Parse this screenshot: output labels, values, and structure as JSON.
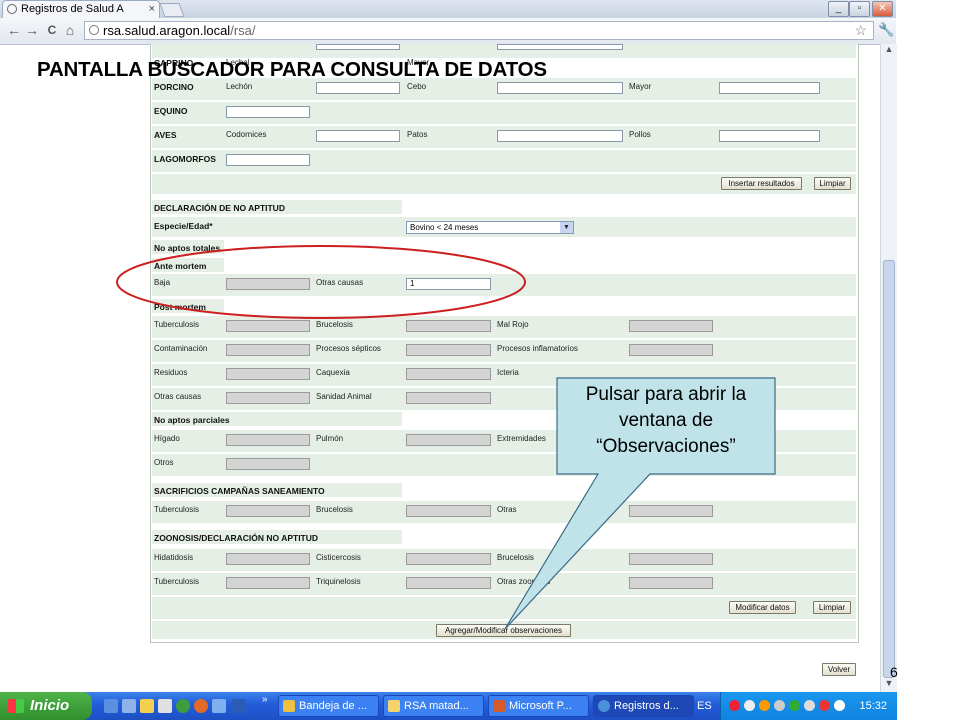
{
  "browser": {
    "tab_title": "Registros de Salud A",
    "tab_close": "×",
    "url_host": "rsa.salud.aragon.local",
    "url_path": "/rsa/",
    "back": "←",
    "forward": "→",
    "reload": "C",
    "home": "⌂",
    "star": "☆",
    "wrench": "🔧",
    "win_min": "_",
    "win_max": "▫",
    "win_close": "✕"
  },
  "slide": {
    "title": "PANTALLA BUSCADOR PARA CONSULTA DE DATOS",
    "callout": "Pulsar para abrir la ventana de “Observaciones”",
    "page_number": "6"
  },
  "form": {
    "top_labels": {
      "caprino": "CAPRINO",
      "caprino_sub": "Lechal",
      "caprino_mayor": "Mayor"
    },
    "porcino": {
      "label": "PORCINO",
      "c1": "Lechón",
      "c2": "Cebo",
      "c3": "Mayor"
    },
    "equino": {
      "label": "EQUINO"
    },
    "aves": {
      "label": "AVES",
      "c1": "Codornices",
      "c2": "Patos",
      "c3": "Pollos"
    },
    "lagomorfos": {
      "label": "LAGOMORFOS"
    },
    "insert_button": "Insertar resultados",
    "clear_button": "Limpiar",
    "no_aptitud": {
      "header": "DECLARACIÓN DE NO APTITUD",
      "species_label": "Especie/Edad*",
      "species_value": "Bovino < 24 meses",
      "no_aptos_totales": "No aptos totales",
      "ante_mortem": "Ante mortem",
      "baja": "Baja",
      "otras_causas": "Otras causas",
      "otras_causas_value": "1",
      "post_mortem": "Post mortem",
      "tuberculosis": "Tuberculosis",
      "brucelosis": "Brucelosis",
      "mal_rojo": "Mal Rojo",
      "contaminacion": "Contaminación",
      "procesos_septicos": "Procesos sépticos",
      "procesos_inflamatorios": "Procesos inflamatorios",
      "residuos": "Residuos",
      "caquexia": "Caquexia",
      "icteria": "Icteria",
      "otras_causas2": "Otras causas",
      "sanidad_animal": "Sanidad Animal",
      "no_aptos_parciales": "No aptos parciales",
      "higado": "Hígado",
      "pulmon": "Pulmón",
      "extremidades": "Extremidades",
      "otros": "Otros"
    },
    "sacrificios": {
      "header": "SACRIFICIOS CAMPAÑAS SANEAMIENTO",
      "tuberculosis": "Tuberculosis",
      "brucelosis": "Brucelosis",
      "otras": "Otras"
    },
    "zoonosis": {
      "header": "ZOONOSIS/DECLARACIÓN NO APTITUD",
      "hidatidosis": "Hidatidosis",
      "cisticercosis": "Cisticercosis",
      "brucelosis": "Brucelosis",
      "tuberculosis": "Tuberculosis",
      "triquinelosis": "Triquinelosis",
      "otras_zoonosis": "Otras zoonosis"
    },
    "modify_button": "Modificar datos",
    "clear_button2": "Limpiar",
    "observations_button": "Agregar/Modificar observaciones",
    "back_button": "Volver"
  },
  "taskbar": {
    "start": "Inicio",
    "items": [
      {
        "label": "Bandeja de ...",
        "color": "#f0c040"
      },
      {
        "label": "RSA matad...",
        "color": "#f5d36a"
      },
      {
        "label": "Microsoft P...",
        "color": "#d65a2a"
      },
      {
        "label": "Registros d...",
        "color": "#4a90d9"
      }
    ],
    "more": "»",
    "lang": "ES",
    "clock": "15:32"
  },
  "colors": {
    "row_bg": "#e6efe6",
    "highlight_ellipse": "#cc1f1f",
    "callout_fill": "#bfe3e8",
    "callout_border": "#3a6a86"
  }
}
